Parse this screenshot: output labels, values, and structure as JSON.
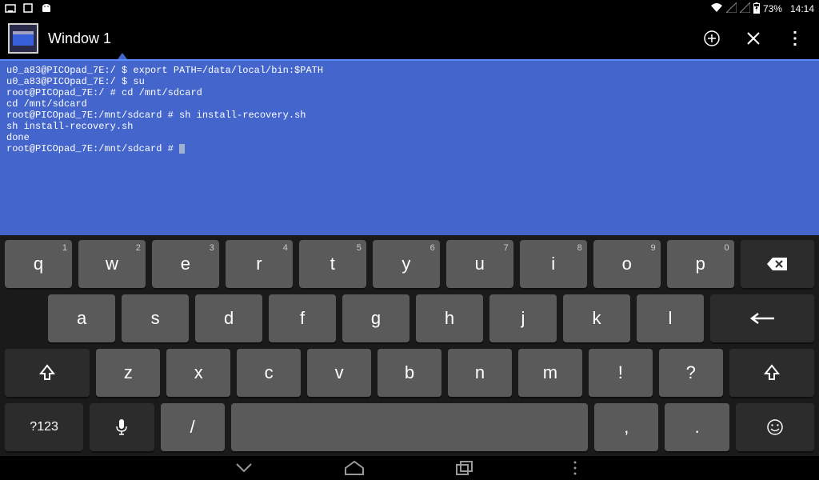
{
  "status": {
    "battery_text": "73%",
    "time": "14:14"
  },
  "actionbar": {
    "title": "Window 1"
  },
  "terminal_lines": [
    "u0_a83@PICOpad_7E:/ $ export PATH=/data/local/bin:$PATH",
    "u0_a83@PICOpad_7E:/ $ su",
    "root@PICOpad_7E:/ # cd /mnt/sdcard",
    "cd /mnt/sdcard",
    "root@PICOpad_7E:/mnt/sdcard # sh install-recovery.sh",
    "sh install-recovery.sh",
    "done",
    "root@PICOpad_7E:/mnt/sdcard # "
  ],
  "keyboard": {
    "row1": [
      {
        "label": "q",
        "sup": "1"
      },
      {
        "label": "w",
        "sup": "2"
      },
      {
        "label": "e",
        "sup": "3"
      },
      {
        "label": "r",
        "sup": "4"
      },
      {
        "label": "t",
        "sup": "5"
      },
      {
        "label": "y",
        "sup": "6"
      },
      {
        "label": "u",
        "sup": "7"
      },
      {
        "label": "i",
        "sup": "8"
      },
      {
        "label": "o",
        "sup": "9"
      },
      {
        "label": "p",
        "sup": "0"
      }
    ],
    "row2": [
      {
        "label": "a"
      },
      {
        "label": "s"
      },
      {
        "label": "d"
      },
      {
        "label": "f"
      },
      {
        "label": "g"
      },
      {
        "label": "h"
      },
      {
        "label": "j"
      },
      {
        "label": "k"
      },
      {
        "label": "l"
      }
    ],
    "row3": [
      {
        "label": "z"
      },
      {
        "label": "x"
      },
      {
        "label": "c"
      },
      {
        "label": "v"
      },
      {
        "label": "b"
      },
      {
        "label": "n"
      },
      {
        "label": "m"
      },
      {
        "label": "!"
      },
      {
        "label": "?"
      }
    ],
    "row4": {
      "symkey": "?123",
      "slash": "/",
      "comma": ",",
      "period": "."
    }
  }
}
